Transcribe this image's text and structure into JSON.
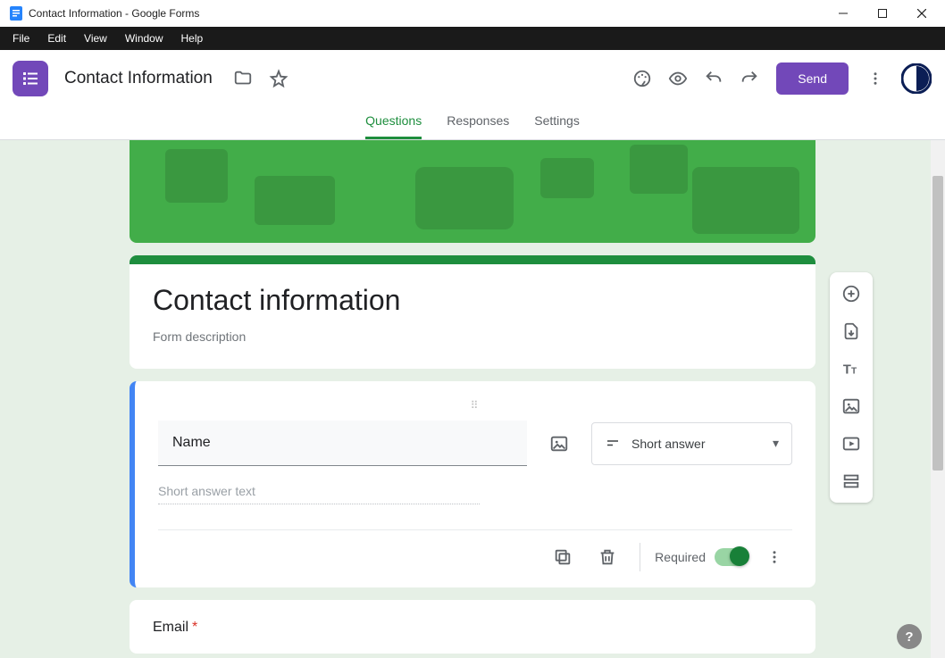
{
  "window": {
    "title": "Contact Information - Google Forms"
  },
  "menubar": [
    "File",
    "Edit",
    "View",
    "Window",
    "Help"
  ],
  "header": {
    "doc_title": "Contact Information",
    "send_label": "Send"
  },
  "tabs": [
    {
      "label": "Questions",
      "active": true
    },
    {
      "label": "Responses",
      "active": false
    },
    {
      "label": "Settings",
      "active": false
    }
  ],
  "title_card": {
    "title": "Contact information",
    "description": "Form description"
  },
  "question": {
    "title": "Name",
    "answer_placeholder": "Short answer text",
    "type_label": "Short answer",
    "required_label": "Required",
    "required": true
  },
  "next_question": {
    "title": "Email",
    "required": true
  }
}
